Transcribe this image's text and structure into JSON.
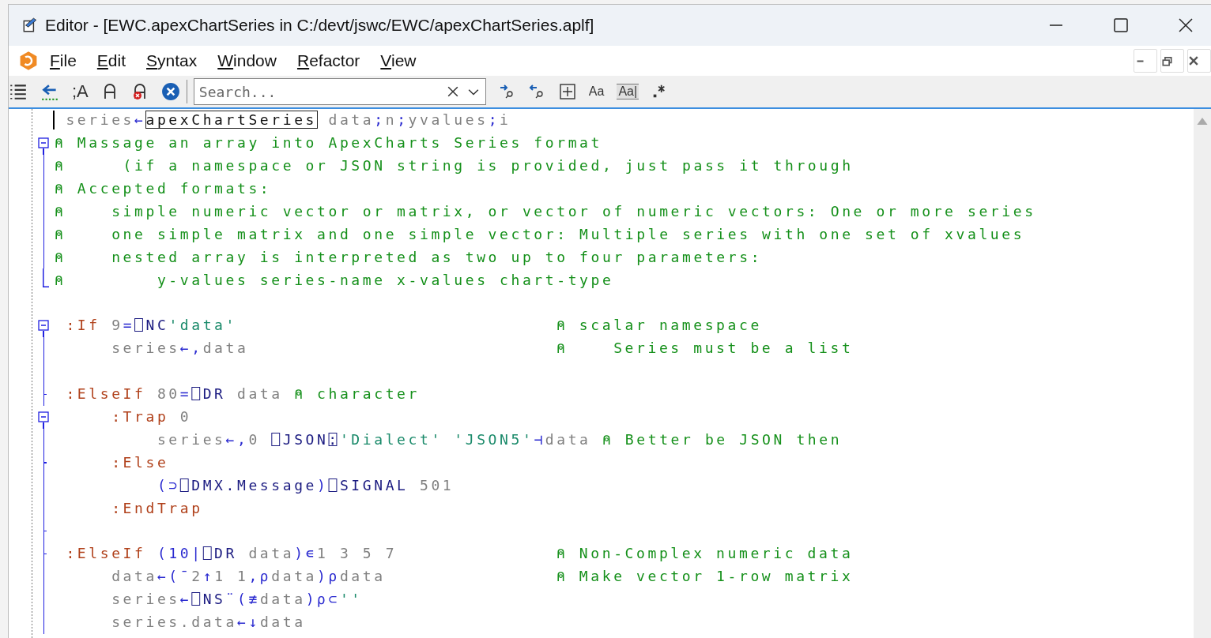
{
  "window": {
    "title": "Editor - [EWC.apexChartSeries in C:/devt/jswc/EWC/apexChartSeries.aplf]"
  },
  "menu": [
    {
      "label": "File"
    },
    {
      "label": "Edit"
    },
    {
      "label": "Syntax"
    },
    {
      "label": "Window"
    },
    {
      "label": "Refactor"
    },
    {
      "label": "View"
    }
  ],
  "toolbar": {
    "comment_glyph": ";A",
    "case_glyph": "Aa",
    "word_glyph": "Aa|"
  },
  "search": {
    "placeholder": "Search..."
  },
  "lines": [
    {
      "kind": "plain",
      "cursor": true,
      "segments": [
        {
          "kind": "name",
          "text": " series"
        },
        {
          "kind": "prim",
          "text": "←"
        },
        {
          "kind": "header",
          "text": "apexChartSeries"
        },
        {
          "kind": "name",
          "text": " data"
        },
        {
          "kind": "prim",
          "text": ";"
        },
        {
          "kind": "name",
          "text": "n"
        },
        {
          "kind": "prim",
          "text": ";"
        },
        {
          "kind": "name",
          "text": "yvalues"
        },
        {
          "kind": "prim",
          "text": ";"
        },
        {
          "kind": "name",
          "text": "i"
        }
      ]
    },
    {
      "kind": "fold",
      "segments": [
        {
          "kind": "comment",
          "text": "⍝ Massage an array into ApexCharts Series format"
        }
      ]
    },
    {
      "kind": "bar",
      "segments": [
        {
          "kind": "comment",
          "text": "⍝     (if a namespace or JSON string is provided, just pass it through"
        }
      ]
    },
    {
      "kind": "bar",
      "segments": [
        {
          "kind": "comment",
          "text": "⍝ Accepted formats:"
        }
      ]
    },
    {
      "kind": "bar",
      "segments": [
        {
          "kind": "comment",
          "text": "⍝    simple numeric vector or matrix, or vector of numeric vectors: One or more series"
        }
      ]
    },
    {
      "kind": "bar",
      "segments": [
        {
          "kind": "comment",
          "text": "⍝    one simple matrix and one simple vector: Multiple series with one set of xvalues"
        }
      ]
    },
    {
      "kind": "bar",
      "segments": [
        {
          "kind": "comment",
          "text": "⍝    nested array is interpreted as two up to four parameters:"
        }
      ]
    },
    {
      "kind": "end",
      "segments": [
        {
          "kind": "comment",
          "text": "⍝        y-values series-name x-values chart-type"
        }
      ]
    },
    {
      "kind": "plain"
    },
    {
      "kind": "fold",
      "segments": [
        {
          "kind": "keyword",
          "text": " :If"
        },
        {
          "kind": "name",
          "text": " 9"
        },
        {
          "kind": "prim",
          "text": "="
        },
        {
          "kind": "sys",
          "text": "⎕NC"
        },
        {
          "kind": "string",
          "text": "'data'"
        }
      ],
      "aside": "⍝ scalar namespace"
    },
    {
      "kind": "bar",
      "segments": [
        {
          "kind": "name",
          "text": "     series"
        },
        {
          "kind": "prim",
          "text": "←,"
        },
        {
          "kind": "name",
          "text": "data"
        }
      ],
      "aside": "⍝    Series must be a list"
    },
    {
      "kind": "bar"
    },
    {
      "kind": "tick",
      "segments": [
        {
          "kind": "keyword",
          "text": " :ElseIf"
        },
        {
          "kind": "name",
          "text": " 80"
        },
        {
          "kind": "prim",
          "text": "="
        },
        {
          "kind": "sys",
          "text": "⎕DR"
        },
        {
          "kind": "name",
          "text": " data "
        },
        {
          "kind": "comment",
          "text": "⍝ character"
        }
      ]
    },
    {
      "kind": "fold",
      "segments": [
        {
          "kind": "keyword",
          "text": "     :Trap"
        },
        {
          "kind": "name",
          "text": " 0"
        }
      ]
    },
    {
      "kind": "bar",
      "segments": [
        {
          "kind": "name",
          "text": "         series"
        },
        {
          "kind": "prim",
          "text": "←,"
        },
        {
          "kind": "name",
          "text": "0 "
        },
        {
          "kind": "sys",
          "text": "⎕JSON⍠"
        },
        {
          "kind": "string",
          "text": "'Dialect' 'JSON5'"
        },
        {
          "kind": "prim",
          "text": "⊣"
        },
        {
          "kind": "name",
          "text": "data "
        },
        {
          "kind": "comment",
          "text": "⍝ Better be JSON then"
        }
      ]
    },
    {
      "kind": "tick",
      "segments": [
        {
          "kind": "keyword",
          "text": "     :Else"
        }
      ]
    },
    {
      "kind": "bar",
      "segments": [
        {
          "kind": "prim",
          "text": "         (⊃"
        },
        {
          "kind": "sys",
          "text": "⎕DMX.Message"
        },
        {
          "kind": "prim",
          "text": ")"
        },
        {
          "kind": "sys",
          "text": "⎕SIGNAL"
        },
        {
          "kind": "name",
          "text": " 501"
        }
      ]
    },
    {
      "kind": "bar",
      "segments": [
        {
          "kind": "keyword",
          "text": "     :EndTrap"
        }
      ]
    },
    {
      "kind": "tick"
    },
    {
      "kind": "tick",
      "segments": [
        {
          "kind": "keyword",
          "text": " :ElseIf"
        },
        {
          "kind": "prim",
          "text": " (10|"
        },
        {
          "kind": "sys",
          "text": "⎕DR"
        },
        {
          "kind": "name",
          "text": " data"
        },
        {
          "kind": "prim",
          "text": ")∊"
        },
        {
          "kind": "name",
          "text": "1 3 5 7"
        }
      ],
      "aside": "⍝ Non-Complex numeric data"
    },
    {
      "kind": "bar",
      "segments": [
        {
          "kind": "name",
          "text": "     data"
        },
        {
          "kind": "prim",
          "text": "←(¯"
        },
        {
          "kind": "name",
          "text": "2"
        },
        {
          "kind": "prim",
          "text": "↑"
        },
        {
          "kind": "name",
          "text": "1 1"
        },
        {
          "kind": "prim",
          "text": ",⍴"
        },
        {
          "kind": "name",
          "text": "data"
        },
        {
          "kind": "prim",
          "text": ")⍴"
        },
        {
          "kind": "name",
          "text": "data"
        }
      ],
      "aside": "⍝ Make vector 1-row matrix"
    },
    {
      "kind": "bar",
      "segments": [
        {
          "kind": "name",
          "text": "     series"
        },
        {
          "kind": "prim",
          "text": "←"
        },
        {
          "kind": "sys",
          "text": "⎕NS"
        },
        {
          "kind": "prim",
          "text": "¨(≢"
        },
        {
          "kind": "name",
          "text": "data"
        },
        {
          "kind": "prim",
          "text": ")⍴⊂"
        },
        {
          "kind": "string",
          "text": "''"
        }
      ]
    },
    {
      "kind": "bar",
      "segments": [
        {
          "kind": "name",
          "text": "     series.data"
        },
        {
          "kind": "prim",
          "text": "←↓"
        },
        {
          "kind": "name",
          "text": "data"
        }
      ]
    }
  ]
}
